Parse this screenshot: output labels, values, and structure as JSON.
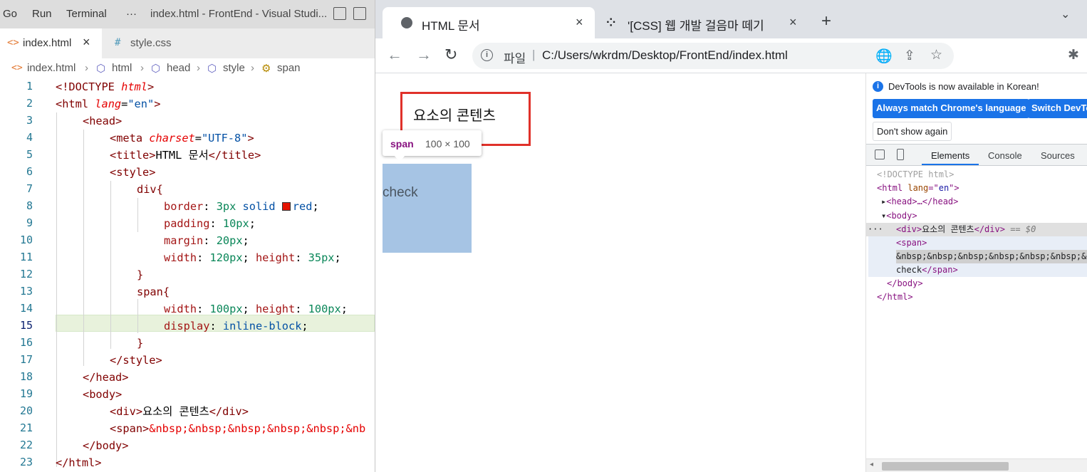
{
  "vscode": {
    "menu": [
      "Go",
      "Run",
      "Terminal",
      "···"
    ],
    "window_title": "index.html - FrontEnd - Visual Studi...",
    "tabs": [
      {
        "icon": "<>",
        "label": "index.html",
        "close": "×"
      },
      {
        "icon": "#",
        "label": "style.css"
      }
    ],
    "breadcrumb": [
      "index.html",
      "html",
      "head",
      "style",
      "span"
    ],
    "line_numbers": [
      "1",
      "2",
      "3",
      "4",
      "5",
      "6",
      "7",
      "8",
      "9",
      "10",
      "11",
      "12",
      "13",
      "14",
      "15",
      "16",
      "17",
      "18",
      "19",
      "20",
      "21",
      "22",
      "23"
    ],
    "code": {
      "l1": "<!DOCTYPE",
      "l1b": "html",
      "l1c": ">",
      "l2_tag": "<html",
      "l2_attr": "lang",
      "l2_eq": "=",
      "l2_val": "\"en\"",
      "l2_end": ">",
      "l3": "<head>",
      "l4_tag": "<meta",
      "l4_attr": "charset",
      "l4_eq": "=",
      "l4_val": "\"UTF-8\"",
      "l4_end": ">",
      "l5_open": "<title>",
      "l5_text": "HTML 문서",
      "l5_close": "</title>",
      "l6": "<style>",
      "l7": "div{",
      "l8_prop": "border",
      "l8_rest1": ": ",
      "l8_num": "3px",
      "l8_rest2": " solid ",
      "l8_val": "red",
      "l8_semi": ";",
      "l9_prop": "padding",
      "l9_num": "10px",
      "l10_prop": "margin",
      "l10_num": "20px",
      "l11_prop1": "width",
      "l11_num1": "120px",
      "l11_prop2": "height",
      "l11_num2": "35px",
      "l12": "}",
      "l13": "span{",
      "l14_prop1": "width",
      "l14_num1": "100px",
      "l14_prop2": "height",
      "l14_num2": "100px",
      "l15_prop": "display",
      "l15_val": "inline-block",
      "l16": "}",
      "l17": "</style>",
      "l18": "</head>",
      "l19": "<body>",
      "l20_open": "<div>",
      "l20_text": "요소의 콘텐츠",
      "l20_close": "</div>",
      "l21_open": "<span>",
      "l21_text": "&nbsp;&nbsp;&nbsp;&nbsp;&nbsp;&nb",
      "l22": "</body>",
      "l23": "</html>"
    }
  },
  "chrome": {
    "tabs": [
      {
        "title": "HTML 문서",
        "close": "×"
      },
      {
        "title": "'[CSS] 웹 개발 걸음마 떼기",
        "close": "×"
      }
    ],
    "new_tab": "+",
    "tab_search": "⌄",
    "address": {
      "scheme": "파일",
      "separator": "|",
      "url": "C:/Users/wkrdm/Desktop/FrontEnd/index.html"
    },
    "page": {
      "div_text": "요소의 콘텐츠",
      "span_text": "check",
      "tooltip_tag": "span",
      "tooltip_dims": "100 × 100"
    },
    "devtools": {
      "notice": "DevTools is now available in Korean!",
      "btn_match": "Always match Chrome's language",
      "btn_switch": "Switch DevTools",
      "btn_dont": "Don't show again",
      "tabs": [
        "Elements",
        "Console",
        "Sources"
      ],
      "dom": {
        "doctype": "<!DOCTYPE html>",
        "html_open": "<html ",
        "html_attr": "lang",
        "html_eq": "=\"",
        "html_val": "en",
        "html_close": "\">",
        "head": "<head>…</head>",
        "body_open": "<body>",
        "div_open": "<div>",
        "div_text": "요소의 콘텐츠",
        "div_close": "</div>",
        "div_sel": "== $0",
        "span_open": "<span>",
        "span_nbsp": "&nbsp;&nbsp;&nbsp;&nbsp;&nbsp;&nbsp;&",
        "span_text": "check",
        "span_close": "</span>",
        "body_close": "</body>",
        "html_end": "</html>",
        "ellipsis": "···"
      }
    }
  }
}
